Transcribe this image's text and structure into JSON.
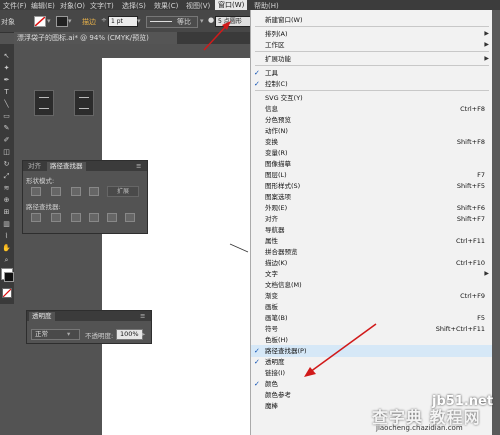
{
  "menubar": {
    "items": [
      "文件(F)",
      "编辑(E)",
      "对象(O)",
      "文字(T)",
      "选择(S)",
      "效果(C)",
      "视图(V)",
      "窗口(W)",
      "帮助(H)"
    ],
    "active_index": 7
  },
  "control_bar": {
    "selection_label": "对象",
    "stroke_label": "描边",
    "stroke_value": "1 pt",
    "profile_label": "等比",
    "brush_label": "5 点圆形"
  },
  "document": {
    "tab_title": "漂浮袋子的图标.ai* @ 94% (CMYK/预览)"
  },
  "pathfinder_panel": {
    "tabs": [
      "对齐",
      "路径查找器"
    ],
    "active_tab": 1,
    "shape_modes_label": "形状模式:",
    "expand_label": "扩展",
    "pathfinders_label": "路径查找器:"
  },
  "transparency_panel": {
    "tab": "透明度",
    "blend_mode": "正常",
    "opacity_label": "不透明度:",
    "opacity_value": "100%"
  },
  "window_menu": {
    "items": [
      {
        "label": "新建窗口(W)",
        "checked": false,
        "shortcut": "",
        "submenu": false
      },
      {
        "sep": true
      },
      {
        "label": "排列(A)",
        "checked": false,
        "shortcut": "",
        "submenu": true
      },
      {
        "label": "工作区",
        "checked": false,
        "shortcut": "",
        "submenu": true
      },
      {
        "sep": true
      },
      {
        "label": "扩展功能",
        "checked": false,
        "shortcut": "",
        "submenu": true
      },
      {
        "sep": true
      },
      {
        "label": "工具",
        "checked": true,
        "shortcut": "",
        "submenu": false
      },
      {
        "label": "控制(C)",
        "checked": true,
        "shortcut": "",
        "submenu": false
      },
      {
        "sep": true
      },
      {
        "label": "SVG 交互(Y)",
        "checked": false,
        "shortcut": "",
        "submenu": false
      },
      {
        "label": "信息",
        "checked": false,
        "shortcut": "Ctrl+F8",
        "submenu": false
      },
      {
        "label": "分色预览",
        "checked": false,
        "shortcut": "",
        "submenu": false
      },
      {
        "label": "动作(N)",
        "checked": false,
        "shortcut": "",
        "submenu": false
      },
      {
        "label": "变换",
        "checked": false,
        "shortcut": "Shift+F8",
        "submenu": false
      },
      {
        "label": "变量(R)",
        "checked": false,
        "shortcut": "",
        "submenu": false
      },
      {
        "label": "图像描摹",
        "checked": false,
        "shortcut": "",
        "submenu": false
      },
      {
        "label": "图层(L)",
        "checked": false,
        "shortcut": "F7",
        "submenu": false
      },
      {
        "label": "图形样式(S)",
        "checked": false,
        "shortcut": "Shift+F5",
        "submenu": false
      },
      {
        "label": "图案选项",
        "checked": false,
        "shortcut": "",
        "submenu": false
      },
      {
        "label": "外观(E)",
        "checked": false,
        "shortcut": "Shift+F6",
        "submenu": false
      },
      {
        "label": "对齐",
        "checked": false,
        "shortcut": "Shift+F7",
        "submenu": false
      },
      {
        "label": "导航器",
        "checked": false,
        "shortcut": "",
        "submenu": false
      },
      {
        "label": "属性",
        "checked": false,
        "shortcut": "Ctrl+F11",
        "submenu": false
      },
      {
        "label": "拼合器预览",
        "checked": false,
        "shortcut": "",
        "submenu": false
      },
      {
        "label": "描边(K)",
        "checked": false,
        "shortcut": "Ctrl+F10",
        "submenu": false
      },
      {
        "label": "文字",
        "checked": false,
        "shortcut": "",
        "submenu": true
      },
      {
        "label": "文档信息(M)",
        "checked": false,
        "shortcut": "",
        "submenu": false
      },
      {
        "label": "渐变",
        "checked": false,
        "shortcut": "Ctrl+F9",
        "submenu": false
      },
      {
        "label": "画板",
        "checked": false,
        "shortcut": "",
        "submenu": false
      },
      {
        "label": "画笔(B)",
        "checked": false,
        "shortcut": "F5",
        "submenu": false
      },
      {
        "label": "符号",
        "checked": false,
        "shortcut": "Shift+Ctrl+F11",
        "submenu": false
      },
      {
        "label": "色板(H)",
        "checked": false,
        "shortcut": "",
        "submenu": false
      },
      {
        "label": "路径查找器(P)",
        "checked": true,
        "shortcut": "",
        "submenu": false,
        "highlight": true
      },
      {
        "label": "透明度",
        "checked": true,
        "shortcut": "",
        "submenu": false
      },
      {
        "label": "链接(I)",
        "checked": false,
        "shortcut": "",
        "submenu": false
      },
      {
        "label": "颜色",
        "checked": true,
        "shortcut": "",
        "submenu": false
      },
      {
        "label": "颜色参考",
        "checked": false,
        "shortcut": "",
        "submenu": false
      },
      {
        "label": "魔棒",
        "checked": false,
        "shortcut": "",
        "submenu": false
      }
    ]
  },
  "watermark": {
    "site": "jb51.net",
    "title": "查字典 教程网",
    "url": "jiaocheng.chazidian.com"
  },
  "colors": {
    "accent_arrow": "#d11a1a",
    "check": "#0b4fb3",
    "highlight_row": "#d6e8f7"
  }
}
